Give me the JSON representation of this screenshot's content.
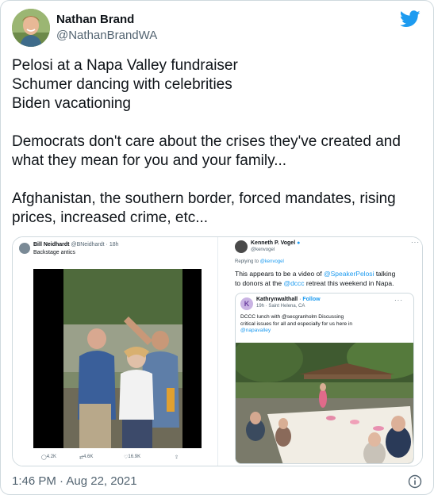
{
  "author": {
    "display_name": "Nathan Brand",
    "handle": "@NathanBrandWA"
  },
  "tweet": {
    "paragraphs": [
      [
        "Pelosi at a Napa Valley fundraiser",
        "Schumer dancing with celebrities",
        "Biden vacationing"
      ],
      [
        "Democrats don't care about the crises they've created and",
        "what they mean for you and your family..."
      ],
      [
        "Afghanistan, the southern border, forced mandates, rising",
        "prices, increased crime, etc..."
      ]
    ],
    "timestamp": "1:46 PM · Aug 22, 2021"
  },
  "embedded_left": {
    "name": "Bill Neidhardt",
    "meta": "@BNeidhardt · 18h",
    "text": "Backstage antics",
    "replies": "4.2K",
    "retweets": "4.6K",
    "likes": "16.9K"
  },
  "embedded_right": {
    "name": "Kenneth P. Vogel",
    "handle": "@kenvogel",
    "replying_prefix": "Replying to",
    "replying_to": "@kenvogel",
    "body": {
      "t1": "This appears to be a video of ",
      "l1": "@SpeakerPelosi",
      "t2": " talking",
      "t3": "to donors at the ",
      "l2": "@dccc",
      "t4": " retreat this weekend in Napa."
    },
    "quote": {
      "initial": "K",
      "name": "Kathrynwalthall",
      "follow": "Follow",
      "meta": "19h · Saint Helena, CA",
      "text1": "DCCC lunch with @secgranholm  Discussing",
      "text2": "critical issues for all and especially for us here in",
      "text3": "@napavalley"
    }
  },
  "colors": {
    "accent": "#1d9bf0",
    "text": "#0f1419",
    "muted": "#536471",
    "border": "#cfd9de"
  },
  "icons": {
    "logo": "twitter-bird-icon",
    "info": "info-circle-icon",
    "verified": "verified-badge-icon"
  }
}
